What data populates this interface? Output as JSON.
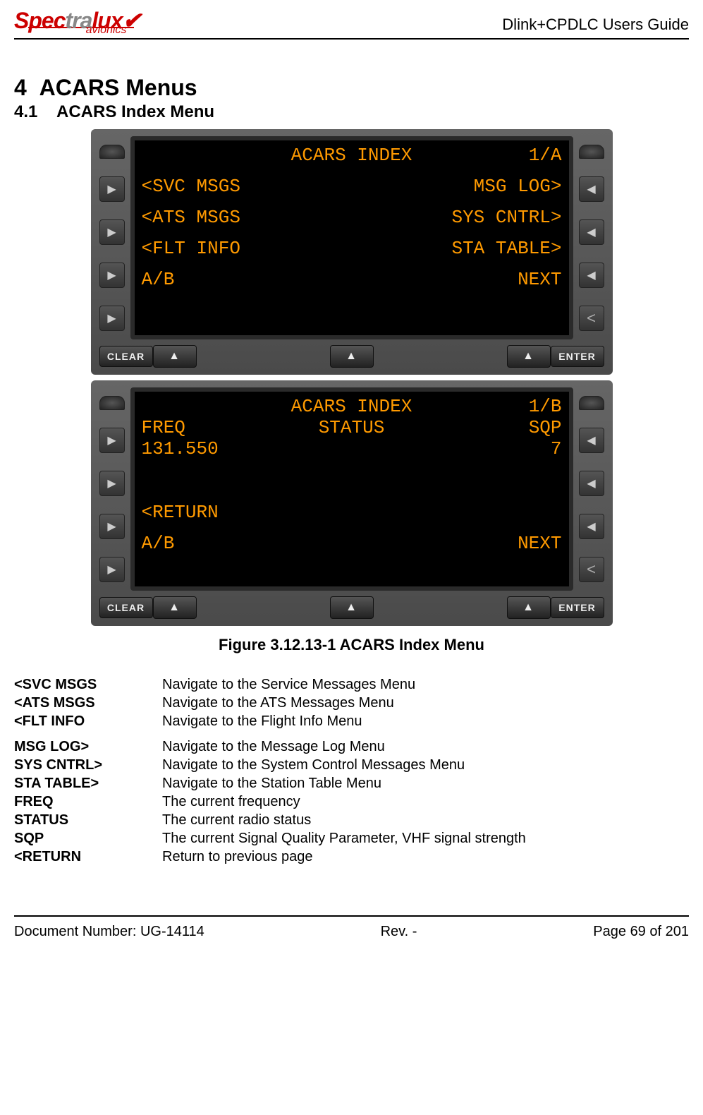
{
  "header": {
    "logo_main": "Spectralux",
    "logo_sub": "avionics",
    "guide_title": "Dlink+CPDLC Users Guide"
  },
  "section": {
    "num": "4",
    "title": "ACARS Menus",
    "sub_num": "4.1",
    "sub_title": "ACARS Index Menu"
  },
  "screen_a": {
    "title": "ACARS INDEX",
    "page": "1/A",
    "l1": "<SVC MSGS",
    "r1": "MSG LOG>",
    "l2": "<ATS MSGS",
    "r2": "SYS CNTRL>",
    "l3": "<FLT INFO",
    "r3": "STA TABLE>",
    "l4": "A/B",
    "r4": "NEXT"
  },
  "screen_b": {
    "title": "ACARS INDEX",
    "page": "1/B",
    "lbl_freq": "FREQ",
    "lbl_status": "STATUS",
    "lbl_sqp": "SQP",
    "val_freq": "131.550",
    "val_sqp": "7",
    "l3": "<RETURN",
    "l4": "A/B",
    "r4": "NEXT"
  },
  "buttons": {
    "clear": "CLEAR",
    "enter": "ENTER"
  },
  "caption": "Figure 3.12.13-1 ACARS Index Menu",
  "definitions": [
    {
      "term": "<SVC MSGS",
      "desc": "Navigate to the Service Messages Menu"
    },
    {
      "term": "<ATS MSGS",
      "desc": "Navigate to the ATS Messages Menu"
    },
    {
      "term": "<FLT INFO",
      "desc": "Navigate to the Flight Info Menu"
    }
  ],
  "definitions2": [
    {
      "term": "MSG LOG>",
      "desc": "Navigate to the Message Log Menu"
    },
    {
      "term": "SYS CNTRL>",
      "desc": "Navigate to the System Control Messages Menu"
    },
    {
      "term": "STA TABLE>",
      "desc": "Navigate to the Station Table Menu"
    },
    {
      "term": "FREQ",
      "desc": "The current frequency"
    },
    {
      "term": "STATUS",
      "desc": "The current radio status"
    },
    {
      "term": "SQP",
      "desc": "The current Signal Quality Parameter, VHF signal strength"
    },
    {
      "term": "<RETURN",
      "desc": "Return to previous page"
    }
  ],
  "footer": {
    "docnum": "Document Number:  UG-14114",
    "rev": "Rev. -",
    "page": "Page 69 of 201"
  }
}
